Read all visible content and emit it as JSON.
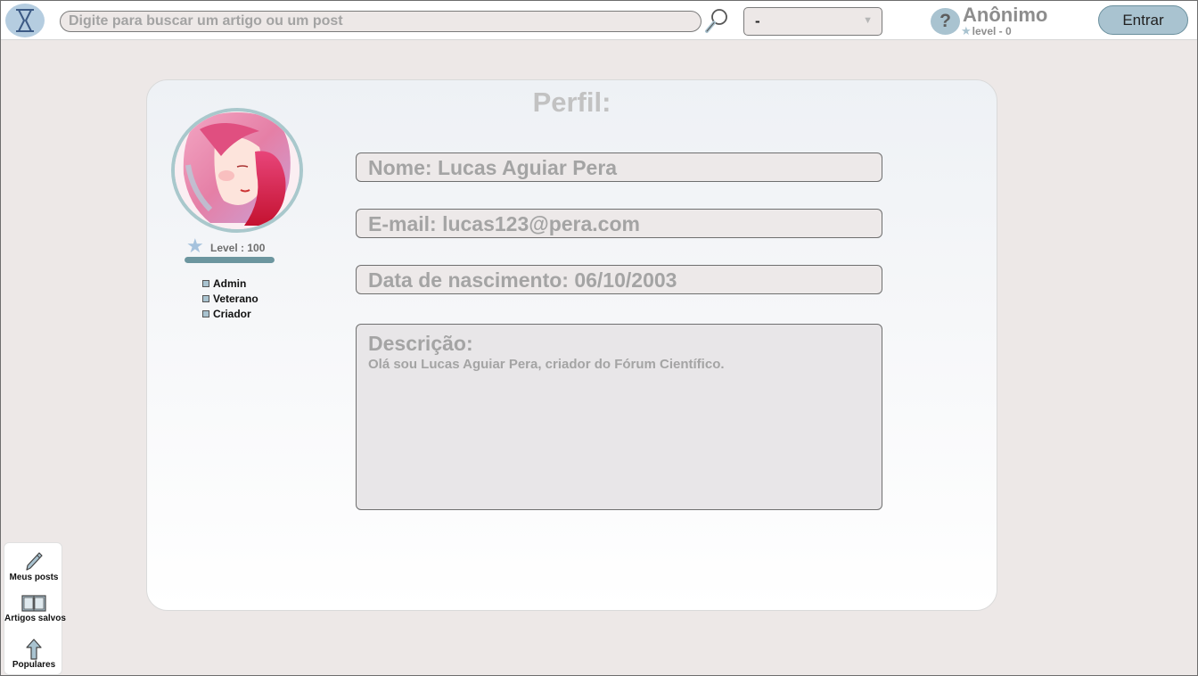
{
  "header": {
    "search_placeholder": "Digite para buscar um artigo ou um post",
    "dropdown_value": "-",
    "help_label": "?",
    "user_name": "Anônimo",
    "user_level": "level - 0",
    "login_label": "Entrar"
  },
  "profile": {
    "title": "Perfil:",
    "level_text": "Level : 100",
    "level_progress": 1.0,
    "badges": [
      "Admin",
      "Veterano",
      "Criador"
    ],
    "name_field": "Nome: Lucas Aguiar Pera",
    "email_field": "E-mail: lucas123@pera.com",
    "birth_field": "Data de nascimento: 06/10/2003",
    "description_label": "Descrição:",
    "description_text": "Olá sou Lucas Aguiar Pera, criador do Fórum Científico."
  },
  "sidenav": {
    "items": [
      {
        "label": "Meus posts",
        "icon": "pencil-icon"
      },
      {
        "label": "Artigos salvos",
        "icon": "open-book-icon"
      },
      {
        "label": "Populares",
        "icon": "arrow-up-icon"
      }
    ]
  },
  "colors": {
    "accent": "#a9c3d0",
    "accent_dark": "#6c969f",
    "background": "#ede8e7",
    "muted_text": "#a4a4a4"
  }
}
